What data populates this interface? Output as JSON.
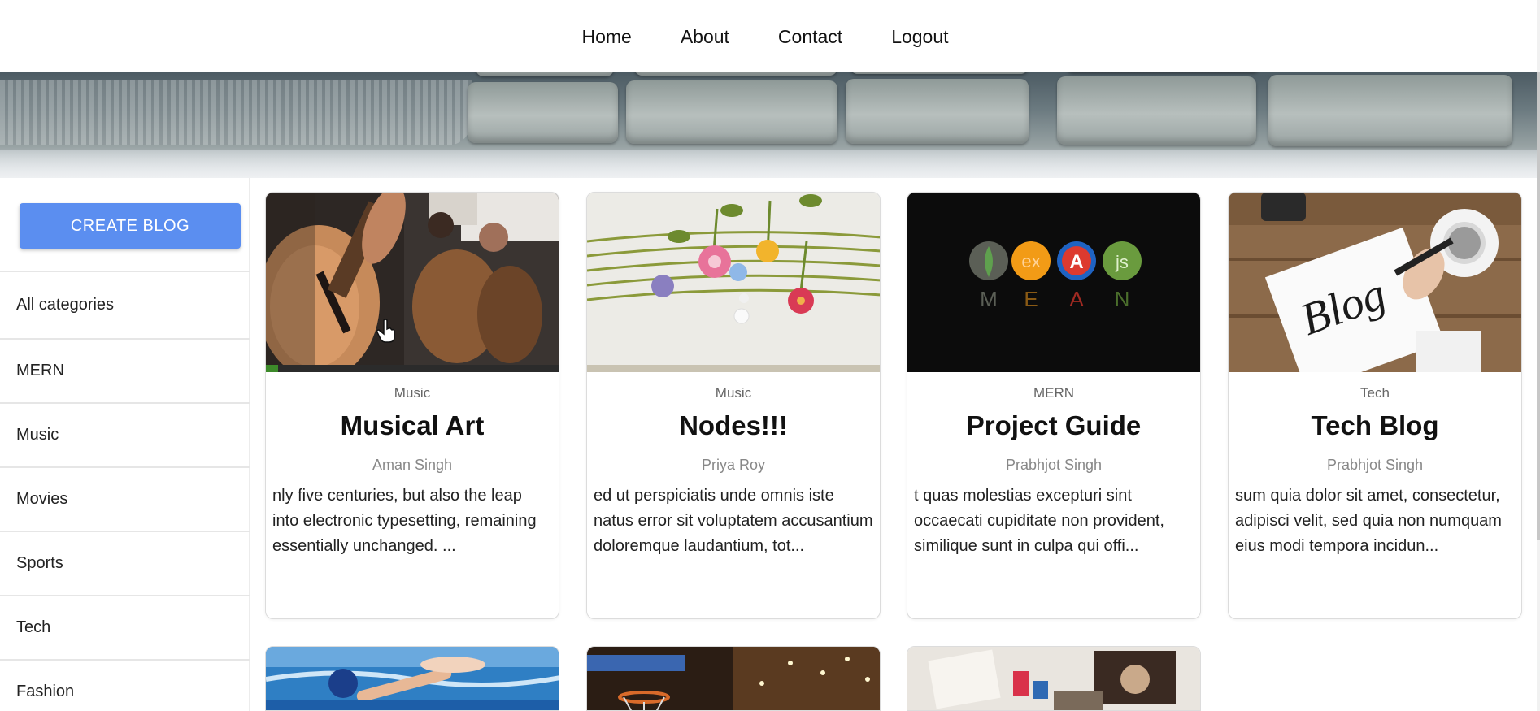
{
  "nav": {
    "links": [
      "Home",
      "About",
      "Contact",
      "Logout"
    ]
  },
  "sidebar": {
    "create_label": "CREATE BLOG",
    "categories": [
      "All categories",
      "MERN",
      "Music",
      "Movies",
      "Sports",
      "Tech",
      "Fashion"
    ]
  },
  "cards": [
    {
      "category": "Music",
      "title": "Musical Art",
      "author": "Aman Singh",
      "excerpt": "nly five centuries, but also the leap into electronic typesetting, remaining essentially unchanged. ..."
    },
    {
      "category": "Music",
      "title": "Nodes!!!",
      "author": "Priya Roy",
      "excerpt": "ed ut perspiciatis unde omnis iste natus error sit voluptatem accusantium doloremque laudantium, tot..."
    },
    {
      "category": "MERN",
      "title": "Project Guide",
      "author": "Prabhjot Singh",
      "excerpt": "t quas molestias excepturi sint occaecati cupiditate non provident, similique sunt in culpa qui offi..."
    },
    {
      "category": "Tech",
      "title": "Tech Blog",
      "author": "Prabhjot Singh",
      "excerpt": "sum quia dolor sit amet, consectetur, adipisci velit, sed quia non numquam eius modi tempora incidun..."
    }
  ],
  "mean_logo": {
    "letters": [
      "M",
      "E",
      "A",
      "N"
    ],
    "badges": [
      "ex",
      "A",
      "js"
    ]
  },
  "blog_sign_text": "Blog",
  "colors": {
    "create_button": "#5b8ef0",
    "nav_text": "#111111",
    "card_border": "#dcdcdc"
  }
}
